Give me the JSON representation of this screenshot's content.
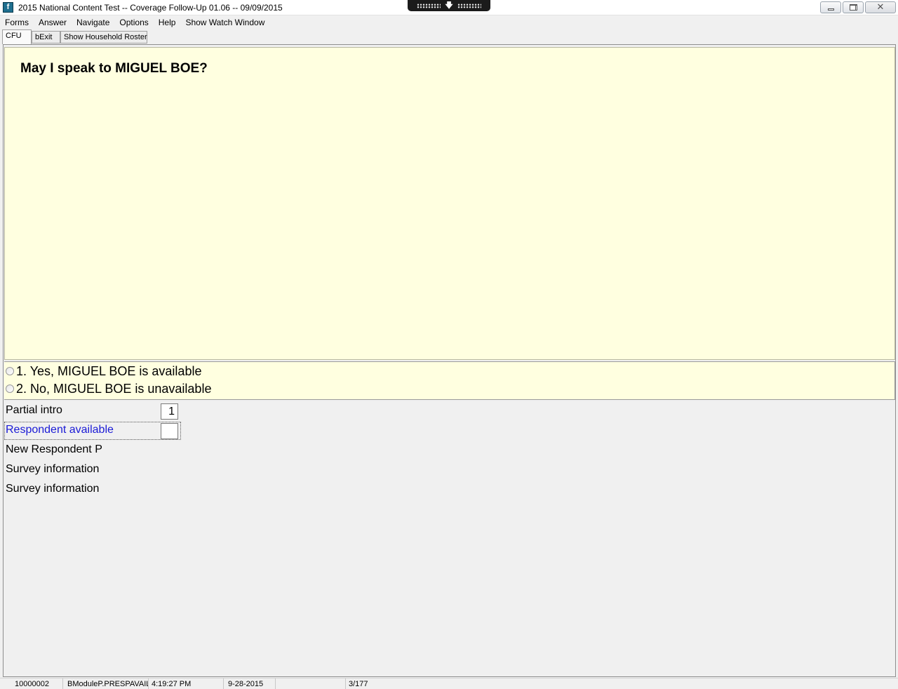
{
  "window": {
    "title": "2015 National Content Test -- Coverage Follow-Up 01.06 -- 09/09/2015",
    "icon_glyph": "f",
    "controls": [
      "minimize-icon",
      "restore-icon",
      "close-icon"
    ]
  },
  "remote_bar": {
    "icon": "arrow-down-icon",
    "glyph": "🡇"
  },
  "menu": {
    "items": [
      "Forms",
      "Answer",
      "Navigate",
      "Options",
      "Help",
      "Show Watch Window"
    ]
  },
  "tabs": [
    "CFU",
    "bExit",
    "Show Household Roster"
  ],
  "question": {
    "text": "May I speak to MIGUEL BOE?"
  },
  "answers": [
    {
      "label": "1. Yes, MIGUEL BOE is available",
      "selected": false
    },
    {
      "label": "2. No, MIGUEL BOE is unavailable",
      "selected": false
    }
  ],
  "fields": [
    {
      "label": "Partial intro",
      "value": "1",
      "has_box": true,
      "current": false
    },
    {
      "label": "Respondent available",
      "value": "",
      "has_box": true,
      "current": true
    },
    {
      "label": "New Respondent P",
      "value": "",
      "has_box": false,
      "current": false
    },
    {
      "label": "Survey information",
      "value": "",
      "has_box": false,
      "current": false
    },
    {
      "label": "Survey information",
      "value": "",
      "has_box": false,
      "current": false
    }
  ],
  "status": {
    "case_id": "10000002",
    "field_name": "BModuleP.PRESPAVAIL",
    "time": "4:19:27 PM",
    "date": "9-28-2015",
    "blank": "",
    "page": "3/177"
  },
  "colors": {
    "question_background": "#ffffe0",
    "current_field_label": "#1a1ad6"
  }
}
